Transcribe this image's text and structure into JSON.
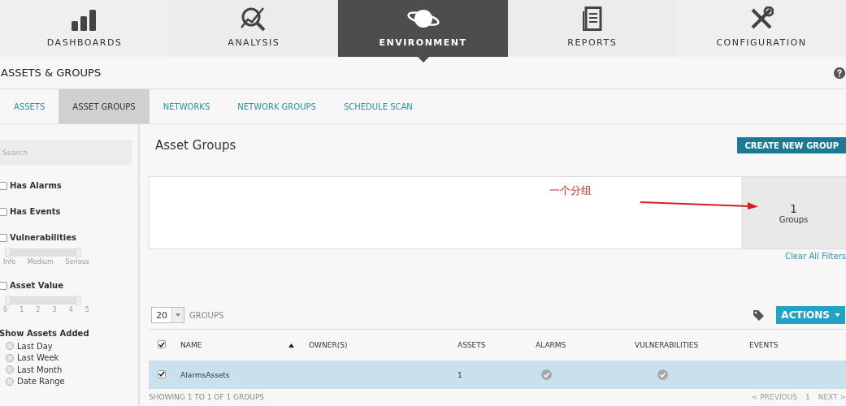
{
  "nav": [
    {
      "label": "DASHBOARDS",
      "selected": false
    },
    {
      "label": "ANALYSIS",
      "selected": false
    },
    {
      "label": "ENVIRONMENT",
      "selected": true
    },
    {
      "label": "REPORTS",
      "selected": false
    },
    {
      "label": "CONFIGURATION",
      "selected": false
    }
  ],
  "page_title": "ASSETS & GROUPS",
  "subtabs": [
    {
      "label": "ASSETS",
      "selected": false
    },
    {
      "label": "ASSET GROUPS",
      "selected": true
    },
    {
      "label": "NETWORKS",
      "selected": false
    },
    {
      "label": "NETWORK GROUPS",
      "selected": false
    },
    {
      "label": "SCHEDULE SCAN",
      "selected": false
    }
  ],
  "sidebar": {
    "search": {
      "placeholder": "Search"
    },
    "filters": [
      {
        "kind": "checkbox",
        "label": "Has Alarms",
        "checked": false
      },
      {
        "kind": "checkbox",
        "label": "Has Events",
        "checked": false
      },
      {
        "kind": "slider",
        "label": "Vulnerabilities",
        "checked": false,
        "level": 1,
        "ticks": [
          "Info",
          "Medium",
          "Serious"
        ]
      },
      {
        "kind": "slider",
        "label": "Asset Value",
        "checked": false,
        "level": 1,
        "ticks": [
          "0",
          "1",
          "2",
          "3",
          "4",
          "5"
        ]
      }
    ],
    "added": {
      "title": "Show Assets Added",
      "options": [
        {
          "label": "Last Day",
          "selected": false
        },
        {
          "label": "Last Week",
          "selected": false
        },
        {
          "label": "Last Month",
          "selected": false
        },
        {
          "label": "Date Range",
          "selected": false
        }
      ]
    }
  },
  "main": {
    "title": "Asset Groups",
    "create_button": "CREATE NEW GROUP",
    "annotation": "一个分组",
    "summary": {
      "count": "1",
      "label": "Groups"
    },
    "clear_filters": "Clear All Filters",
    "page_size": "20",
    "page_size_label": "GROUPS",
    "actions_button": "ACTIONS",
    "table": {
      "select_all_checked": true,
      "columns": [
        {
          "label": "NAME",
          "sorted": true
        },
        {
          "label": "OWNER(S)",
          "sorted": false
        },
        {
          "label": "ASSETS",
          "sorted": false
        },
        {
          "label": "ALARMS",
          "sorted": false
        },
        {
          "label": "VULNERABILITIES",
          "sorted": false
        },
        {
          "label": "EVENTS",
          "sorted": false
        }
      ],
      "rows": [
        {
          "checked": true,
          "selected": true,
          "name": "AlarmsAssets",
          "assets": "1",
          "alarms": true,
          "vulnerabilities": true
        }
      ]
    },
    "footer": "SHOWING 1 TO 1 OF 1 GROUPS",
    "pagination": {
      "previous": "< PREVIOUS",
      "page": "1",
      "next": "NEXT >"
    }
  }
}
